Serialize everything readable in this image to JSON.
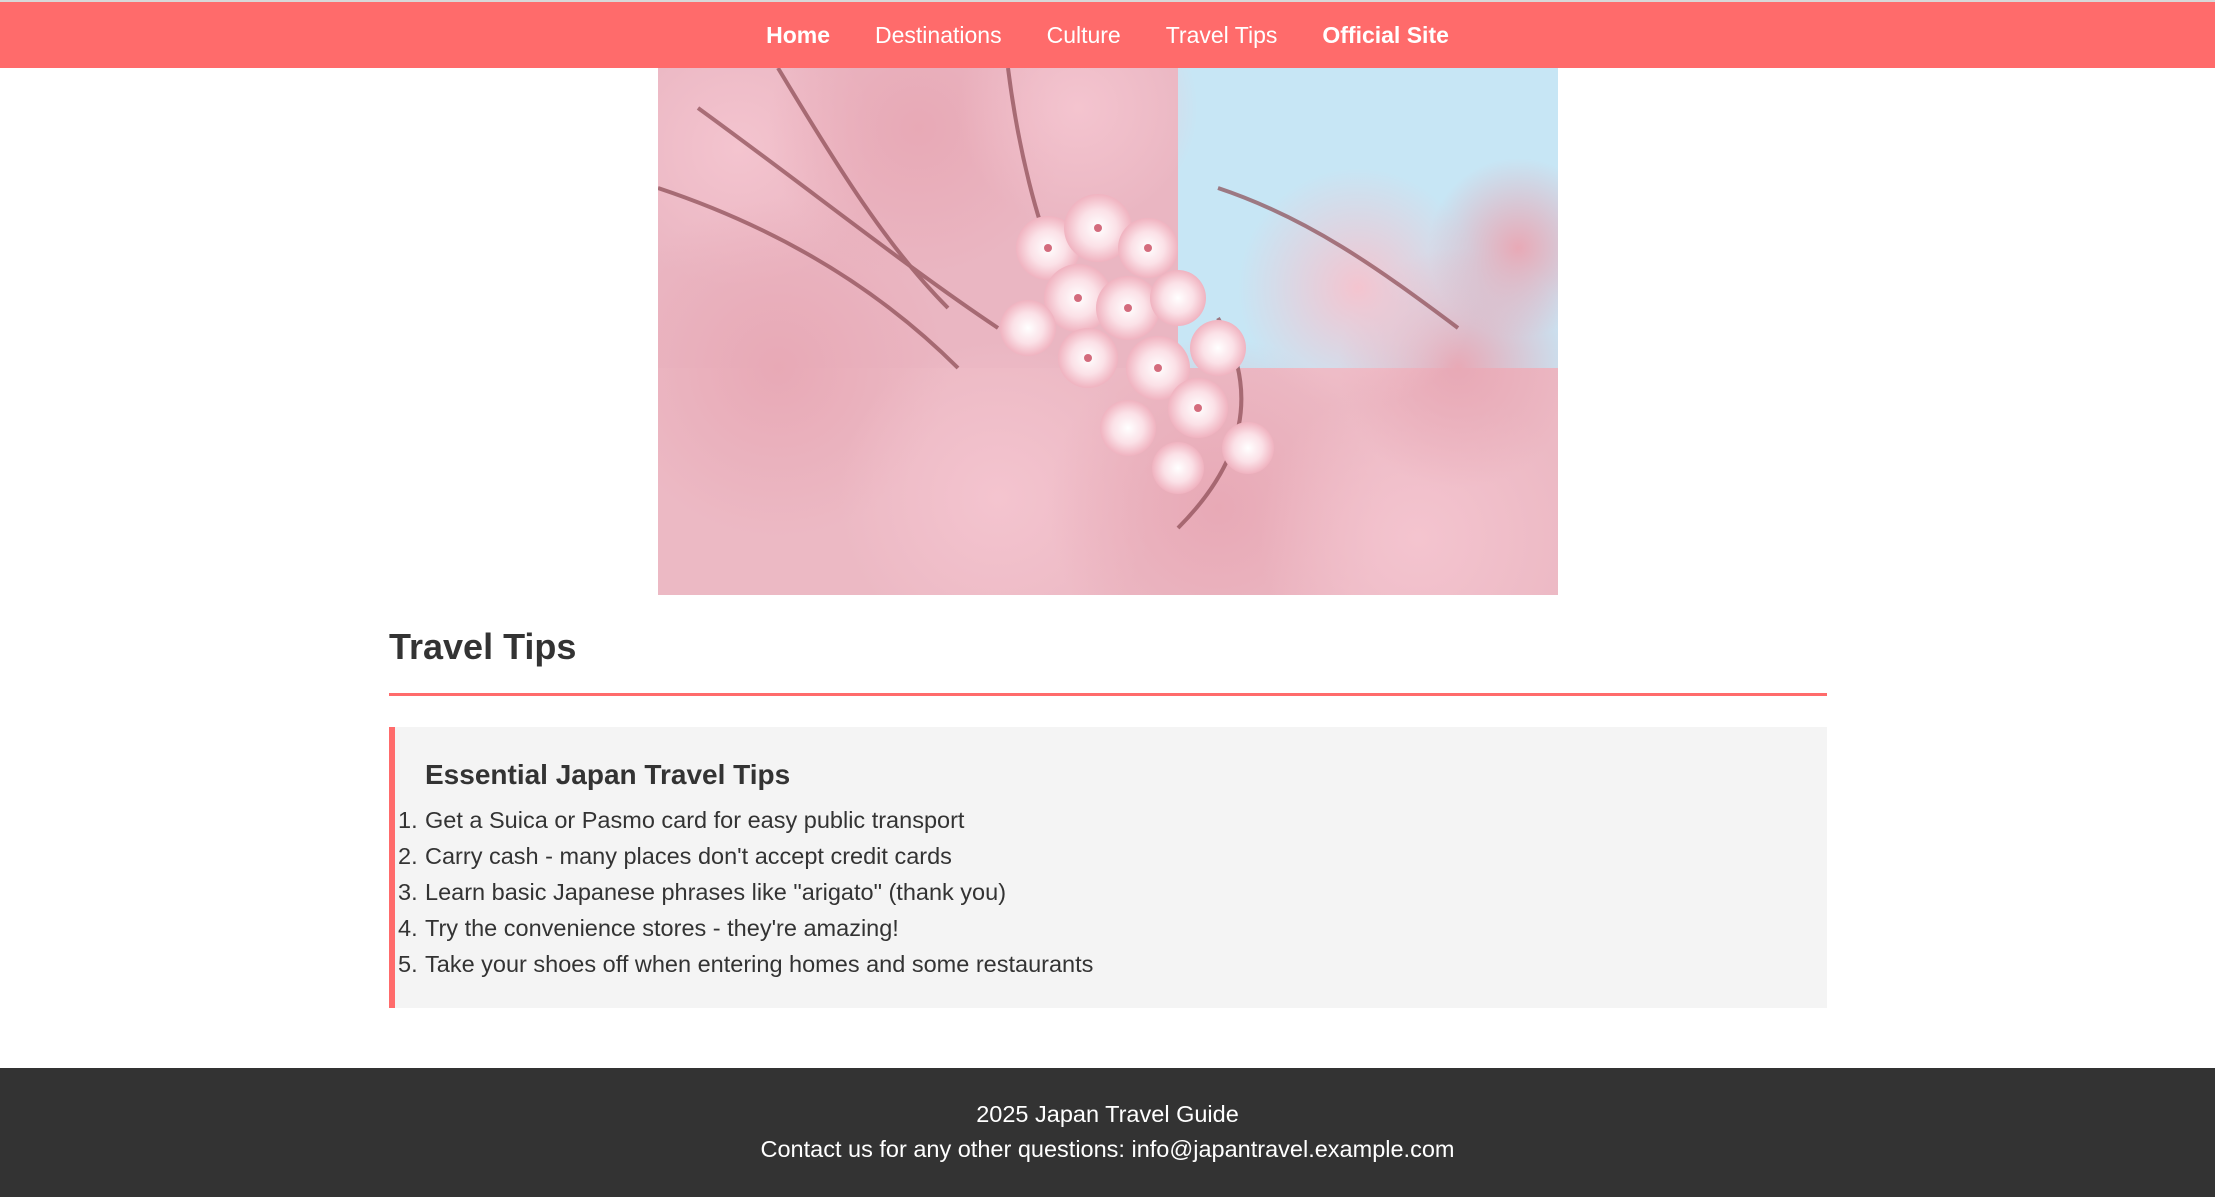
{
  "nav": {
    "items": [
      {
        "label": "Home",
        "bold": true
      },
      {
        "label": "Destinations",
        "bold": false
      },
      {
        "label": "Culture",
        "bold": false
      },
      {
        "label": "Travel Tips",
        "bold": false
      },
      {
        "label": "Official Site",
        "bold": true
      }
    ]
  },
  "hero": {
    "image": "cherry-blossom-photo"
  },
  "section": {
    "title": "Travel Tips"
  },
  "tips": {
    "heading": "Essential Japan Travel Tips",
    "items": [
      {
        "num": "1.",
        "text": "Get a Suica or Pasmo card for easy public transport"
      },
      {
        "num": "2.",
        "text": "Carry cash - many places don't accept credit cards"
      },
      {
        "num": "3.",
        "text": "Learn basic Japanese phrases like \"arigato\" (thank you)"
      },
      {
        "num": "4.",
        "text": "Try the convenience stores - they're amazing!"
      },
      {
        "num": "5.",
        "text": "Take your shoes off when entering homes and some restaurants"
      }
    ]
  },
  "footer": {
    "line1": "2025 Japan Travel Guide",
    "line2": "Contact us for any other questions: info@japantravel.example.com"
  },
  "colors": {
    "accent": "#ff6b6b",
    "footer_bg": "#333333",
    "card_bg": "#f4f4f4",
    "text": "#333333"
  }
}
